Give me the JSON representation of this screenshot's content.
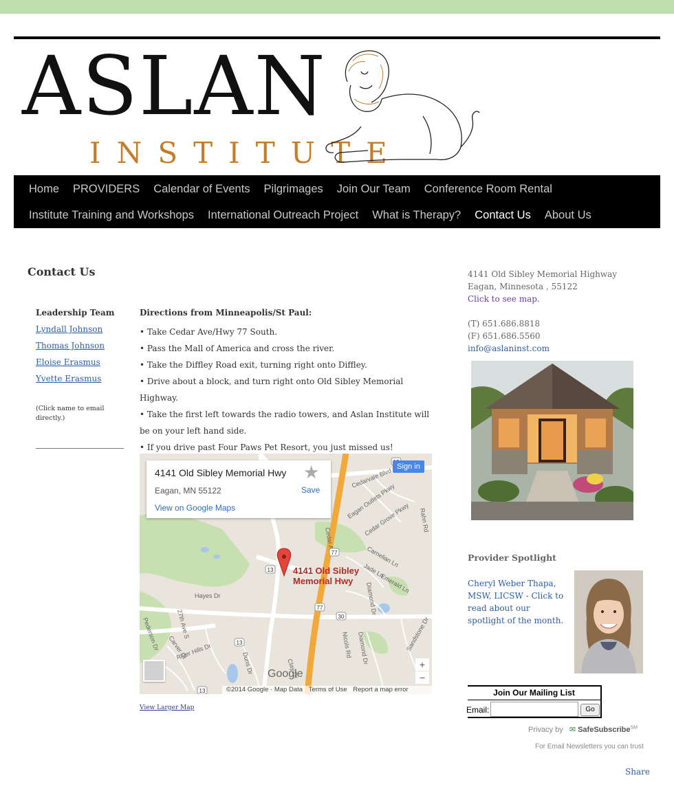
{
  "logo": {
    "line1": "ASLAN",
    "line2": "INSTITUTE"
  },
  "nav": {
    "row1": [
      "Home",
      "PROVIDERS",
      "Calendar of Events",
      "Pilgrimages",
      "Join Our Team",
      "Conference Room Rental"
    ],
    "row2": [
      "Institute Training and Workshops",
      "International Outreach Project",
      "What is Therapy?",
      "Contact Us",
      "About Us"
    ],
    "active": "Contact Us"
  },
  "main": {
    "title": "Contact Us",
    "leadership": {
      "heading": "Leadership Team",
      "people": [
        "Lyndall Johnson",
        "Thomas Johnson",
        "Eloise Erasmus",
        "Yvette Erasmus"
      ],
      "note": "(Click name to email directly.)"
    },
    "directions": {
      "heading": "Directions from Minneapolis/St Paul:",
      "steps": [
        "• Take Cedar Ave/Hwy 77 South.",
        "• Pass the Mall of America and cross the river.",
        "• Take the Diffley Road exit, turning right onto Diffley.",
        "• Drive about a block, and turn right onto Old Sibley Memorial Highway.",
        "• Take the first left towards the radio towers, and Aslan Institute will be on your left hand side.",
        "• If you drive past Four Paws Pet Resort, you just missed us!"
      ]
    },
    "map": {
      "card_address1": "4141 Old Sibley Memorial Hwy",
      "card_address2": "Eagan, MN 55122",
      "save_label": "Save",
      "view_on_maps": "View on Google Maps",
      "sign_in": "Sign in",
      "marker_label_line1": "4141 Old Sibley",
      "marker_label_line2": "Memorial Hwy",
      "google_logo": "Google",
      "footer_copyright": "©2014 Google · Map Data",
      "footer_terms": "Terms of Use",
      "footer_report": "Report a map error",
      "zoom_in": "+",
      "zoom_out": "−",
      "street_labels": [
        "Cedarvale Blvd",
        "Eagan Outlets Pkwy",
        "Cedar Grove Pkwy",
        "Rahn Rd",
        "Cedar Ave",
        "Carnelian Ln",
        "Jade Ln",
        "Emerald Ln",
        "Diamond Dr",
        "Hayes Dr",
        "27th Ave S",
        "Carver Ct",
        "River Hills Dr",
        "Nicols Rd",
        "Sandstone Dr",
        "Pederson Dr",
        "Clay Dr",
        "Duns Dr"
      ],
      "route_shields": [
        "13",
        "77",
        "30",
        "13",
        "77",
        "13",
        "13"
      ]
    },
    "view_larger_map": "View Larger Map"
  },
  "sidebar": {
    "address_line1": "4141 Old Sibley Memorial Highway",
    "address_line2": "Eagan, Minnesota , 55122",
    "map_link": "Click to see map.",
    "phone": "(T) 651.686.8818",
    "fax": "(F) 651.686.5560",
    "email": "info@aslaninst.com",
    "spotlight_heading": "Provider Spotlight",
    "spotlight_text": "Cheryl Weber Thapa, MSW, LICSW - Click to read about our spotlight of the month.",
    "mailing_list": {
      "title": "Join Our Mailing List",
      "email_label": "Email:",
      "email_value": "",
      "go_label": "Go"
    },
    "privacy_by": "Privacy by",
    "safesubscribe": "SafeSubscribe",
    "safesubscribe_sup": "SM",
    "trust_line": "For Email Newsletters you can trust",
    "share": "Share"
  },
  "colors": {
    "top_bar": "#bddfad",
    "nav_bg": "#000000",
    "link_blue": "#2b5ea8",
    "map_link_purple": "#6a3fa0",
    "logo_gold": "#c47d2a"
  }
}
